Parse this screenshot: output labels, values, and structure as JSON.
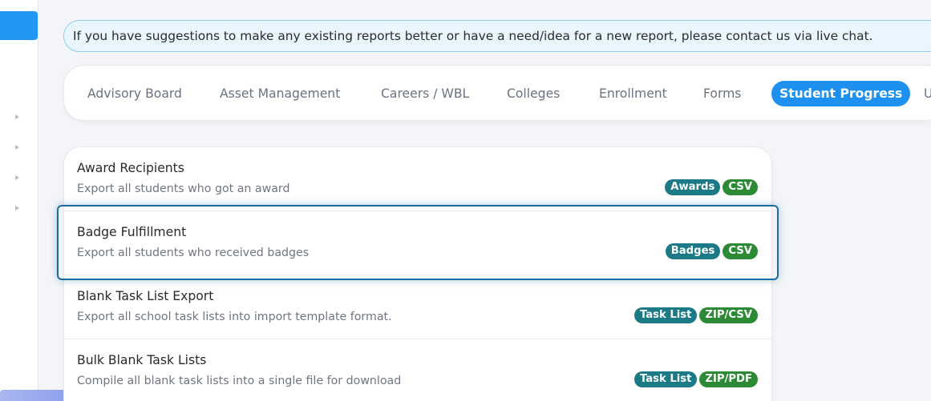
{
  "banner": {
    "text": "If you have suggestions to make any existing reports better or have a need/idea for a new report, please contact us via live chat."
  },
  "tabs": [
    {
      "label": "Advisory Board",
      "active": false
    },
    {
      "label": "Asset Management",
      "active": false
    },
    {
      "label": "Careers / WBL",
      "active": false
    },
    {
      "label": "Colleges",
      "active": false
    },
    {
      "label": "Enrollment",
      "active": false
    },
    {
      "label": "Forms",
      "active": false
    },
    {
      "label": "Student Progress",
      "active": true
    },
    {
      "label": "U",
      "active": false
    }
  ],
  "reports": [
    {
      "title": "Award Recipients",
      "description": "Export all students who got an award",
      "category": "Awards",
      "format": "CSV"
    },
    {
      "title": "Badge Fulfillment",
      "description": "Export all students who received badges",
      "category": "Badges",
      "format": "CSV"
    },
    {
      "title": "Blank Task List Export",
      "description": "Export all school task lists into import template format.",
      "category": "Task List",
      "format": "ZIP/CSV"
    },
    {
      "title": "Bulk Blank Task Lists",
      "description": "Compile all blank task lists into a single file for download",
      "category": "Task List",
      "format": "ZIP/PDF"
    }
  ],
  "sidebar": {
    "stub_text": "..."
  },
  "colors": {
    "accent": "#1e90f0",
    "category_tag": "#1c7a86",
    "format_tag": "#2c8a34",
    "highlight": "#1a6b9f"
  }
}
